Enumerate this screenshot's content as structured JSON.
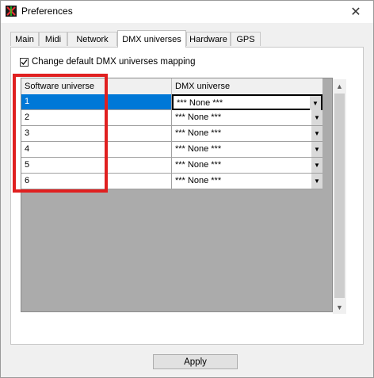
{
  "window": {
    "title": "Preferences",
    "close_glyph": "✕"
  },
  "tabs": [
    {
      "label": "Main"
    },
    {
      "label": "Midi"
    },
    {
      "label": "Network"
    },
    {
      "label": "DMX universes"
    },
    {
      "label": "Hardware"
    },
    {
      "label": "GPS"
    }
  ],
  "active_tab": "DMX universes",
  "mapping": {
    "checkbox_label": "Change default DMX universes mapping",
    "checked": true
  },
  "grid": {
    "headers": [
      "Software universe",
      "DMX universe"
    ],
    "rows": [
      {
        "software": "1",
        "dmx": "*** None ***"
      },
      {
        "software": "2",
        "dmx": "*** None ***"
      },
      {
        "software": "3",
        "dmx": "*** None ***"
      },
      {
        "software": "4",
        "dmx": "*** None ***"
      },
      {
        "software": "5",
        "dmx": "*** None ***"
      },
      {
        "software": "6",
        "dmx": "*** None ***"
      }
    ],
    "selected_row": 1
  },
  "footer": {
    "apply_label": "Apply"
  },
  "colors": {
    "selection": "#0078d7",
    "highlight": "#e02020"
  }
}
